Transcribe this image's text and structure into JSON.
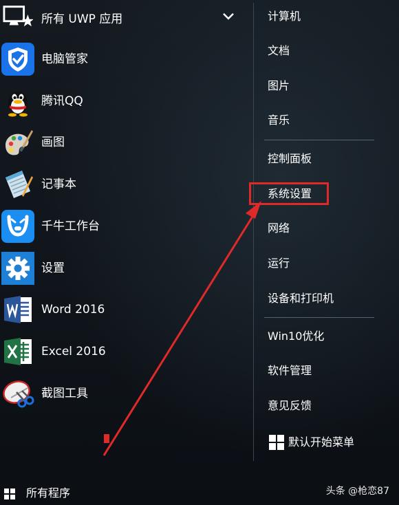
{
  "left_pane": {
    "apps": [
      {
        "label": "所有 UWP 应用",
        "icon": "monitor-star-icon"
      },
      {
        "label": "电脑管家",
        "icon": "shield-check-icon"
      },
      {
        "label": "腾讯QQ",
        "icon": "qq-penguin-icon"
      },
      {
        "label": "画图",
        "icon": "paint-palette-icon"
      },
      {
        "label": "记事本",
        "icon": "notepad-icon"
      },
      {
        "label": "千牛工作台",
        "icon": "qianniu-icon"
      },
      {
        "label": "设置",
        "icon": "gear-icon"
      },
      {
        "label": "Word 2016",
        "icon": "word-icon"
      },
      {
        "label": "Excel 2016",
        "icon": "excel-icon"
      },
      {
        "label": "截图工具",
        "icon": "snipping-tool-icon"
      }
    ]
  },
  "right_pane": {
    "items": [
      {
        "label": "计算机"
      },
      {
        "label": "文档"
      },
      {
        "label": "图片"
      },
      {
        "label": "音乐"
      },
      {
        "label": "控制面板"
      },
      {
        "label": "系统设置"
      },
      {
        "label": "网络"
      },
      {
        "label": "运行"
      },
      {
        "label": "设备和打印机"
      },
      {
        "label": "Win10优化"
      },
      {
        "label": "软件管理"
      },
      {
        "label": "意见反馈"
      },
      {
        "label": "默认开始菜单"
      }
    ]
  },
  "bottom": {
    "all_programs_label": "所有程序",
    "watermark": "头条 @枪恋87"
  },
  "colors": {
    "background": "#10151b",
    "highlight": "#e02a2a",
    "word_blue": "#2b579a",
    "excel_green": "#217346",
    "shield_blue": "#1a73e8",
    "settings_blue": "#1e7fd6"
  }
}
